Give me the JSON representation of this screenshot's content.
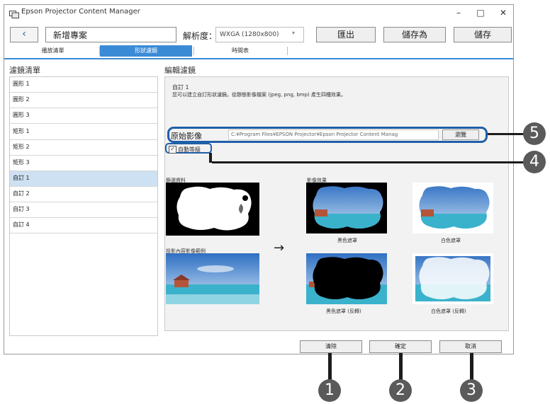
{
  "window": {
    "title": "Epson Projector Content Manager",
    "minimize": "–",
    "maximize": "□",
    "close": "✕"
  },
  "toolbar": {
    "back_icon": "‹",
    "project_name": "新增專案",
    "resolution_label": "解析度：",
    "resolution_value": "WXGA (1280x800)",
    "export_label": "匯出",
    "save_as_label": "儲存為",
    "save_label": "儲存"
  },
  "tabs": [
    {
      "label": "播放清單",
      "active": false
    },
    {
      "label": "形狀濾鏡",
      "active": true
    },
    {
      "label": "時間表",
      "active": false
    }
  ],
  "filter_list": {
    "heading": "濾鏡清單",
    "items": [
      "圓形 1",
      "圓形 2",
      "圓形 3",
      "矩形 1",
      "矩形 2",
      "矩形 3",
      "自訂 1",
      "自訂 2",
      "自訂 3",
      "自訂 4"
    ],
    "selected_index": 6
  },
  "edit_filter": {
    "heading": "編輯濾鏡",
    "name": "自訂 1",
    "description": "您可以建立自訂形狀濾鏡。從靜態影像檔案 (jpeg, png, bmp) 產生四種效果。",
    "original_image_label": "原始影像",
    "original_image_path": "C:¥Program Files¥EPSON Projector¥Epson Projector Content Manag",
    "browse_label": "瀏覽",
    "auto_level_label": "自動等級",
    "auto_level_checked": true,
    "filter_data_label": "篩選資料",
    "sample_label": "投影內容影像範例",
    "effects_label": "影像效果",
    "effect_black_mask": "黑色遮罩",
    "effect_white_mask": "白色遮罩",
    "effect_black_mask_inverted": "黑色遮罩 (反轉)",
    "effect_white_mask_inverted": "白色遮罩 (反轉)",
    "arrow": "→"
  },
  "buttons": {
    "clear": "清除",
    "ok": "確定",
    "cancel": "取消"
  },
  "callouts": [
    "1",
    "2",
    "3",
    "4",
    "5"
  ],
  "colors": {
    "accent": "#3a8bd6",
    "callout_box": "#1f5fa8",
    "callout_circle": "#5a5a5a",
    "selected_row": "#cde1f2"
  }
}
